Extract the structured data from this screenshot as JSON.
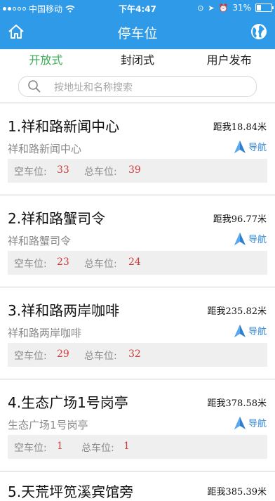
{
  "status_bar": {
    "carrier": "中国移动",
    "time": "下午4:47",
    "battery": "31%"
  },
  "navbar": {
    "title": "停车位",
    "home_icon": "home-icon",
    "globe_icon": "globe-icon"
  },
  "tabs": [
    {
      "label": "开放式",
      "active": true
    },
    {
      "label": "封闭式",
      "active": false
    },
    {
      "label": "用户发布",
      "active": false
    }
  ],
  "search": {
    "placeholder": "按地址和名称搜索"
  },
  "labels": {
    "free_spots": "空车位:",
    "total_spots": "总车位:",
    "navigate": "导航"
  },
  "accent_colors": {
    "header_blue": "#2f9be8",
    "active_tab_green": "#3fae5a",
    "value_red": "#d23a3a"
  },
  "items": [
    {
      "name": "1.祥和路新闻中心",
      "distance": "距我18.84米",
      "sub": "祥和路新闻中心",
      "free": "33",
      "total": "39"
    },
    {
      "name": "2.祥和路蟹司令",
      "distance": "距我96.77米",
      "sub": "祥和路蟹司令",
      "free": "23",
      "total": "24"
    },
    {
      "name": "3.祥和路两岸咖啡",
      "distance": "距我235.82米",
      "sub": "祥和路两岸咖啡",
      "free": "29",
      "total": "32"
    },
    {
      "name": "4.生态广场1号岗亭",
      "distance": "距我378.58米",
      "sub": "生态广场1号岗亭",
      "free": "1",
      "total": "1"
    },
    {
      "name": "5.天荒坪笕溪宾馆旁",
      "distance": "距我385.39米",
      "sub": "",
      "free": "",
      "total": ""
    }
  ]
}
